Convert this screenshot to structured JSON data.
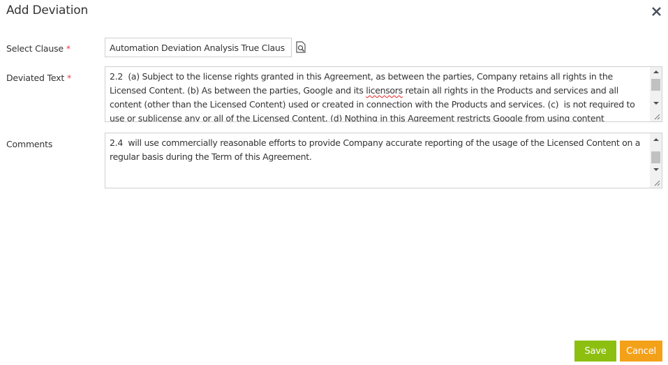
{
  "dialog": {
    "title": "Add Deviation",
    "close_icon": "close-icon"
  },
  "form": {
    "required_marker": "*",
    "select_clause": {
      "label": "Select Clause",
      "value": "Automation Deviation Analysis True Claus",
      "lookup_icon": "document-search-icon"
    },
    "deviated_text": {
      "label": "Deviated Text",
      "value_before": "2.2  (a) Subject to the license rights granted in this Agreement, as between the parties, Company retains all rights in the Licensed Content. (b) As between the parties, Google and its ",
      "value_misspelled": "licensors",
      "value_after": " retain all rights in the Products and services and all content (other than the Licensed Content) used or created in connection with the Products and services. (c)  is not required to use or sublicense any or all of the Licensed Content. (d) Nothing in this Agreement restricts Google from using content"
    },
    "comments": {
      "label": "Comments",
      "value": "2.4  will use commercially reasonable efforts to provide Company accurate reporting of the usage of the Licensed Content on a regular basis during the Term of this Agreement."
    }
  },
  "actions": {
    "save_label": "Save",
    "cancel_label": "Cancel"
  },
  "colors": {
    "save": "#8dbf10",
    "cancel": "#f4a11a",
    "required": "#e8414a"
  }
}
